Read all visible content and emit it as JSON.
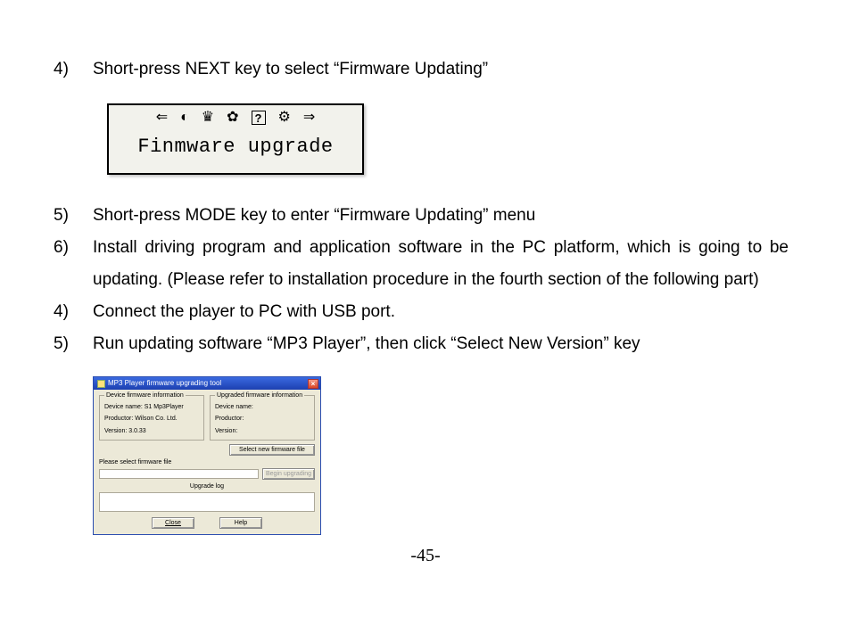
{
  "steps": [
    {
      "num": "4)",
      "text": "Short-press NEXT key to select “Firmware Updating”"
    },
    {
      "num": "5)",
      "text": "Short-press MODE key to enter “Firmware Updating” menu"
    },
    {
      "num": "6)",
      "text": "Install driving program and application software in the PC platform, which is going to be updating. (Please refer to installation procedure in the fourth section of the following part)"
    },
    {
      "num": "4)",
      "text": "Connect the player to PC with USB port."
    },
    {
      "num": "5)",
      "text": "Run updating software “MP3 Player”, then click “Select New Version” key"
    }
  ],
  "lcd": {
    "icons": [
      "⇐",
      "◐",
      "♛",
      "✿",
      "?",
      "⚙",
      "⇒"
    ],
    "label": "Finmware upgrade"
  },
  "dialog": {
    "title": "MP3 Player firmware upgrading tool",
    "close": "×",
    "group_left": {
      "legend": "Device firmware information",
      "rows": [
        "Device name: S1 Mp3Player",
        "Productor: Wilson Co. Ltd.",
        "Version: 3.0.33"
      ]
    },
    "group_right": {
      "legend": "Upgraded firmware information",
      "rows": [
        "Device name:",
        "Productor:",
        "Version:"
      ]
    },
    "select_btn": "Select new firmware file",
    "please_label": "Please select firmware file",
    "begin_btn": "Begin upgrading",
    "log_label": "Upgrade log",
    "close_btn": "Close",
    "help_btn": "Help"
  },
  "page_number": "-45-"
}
